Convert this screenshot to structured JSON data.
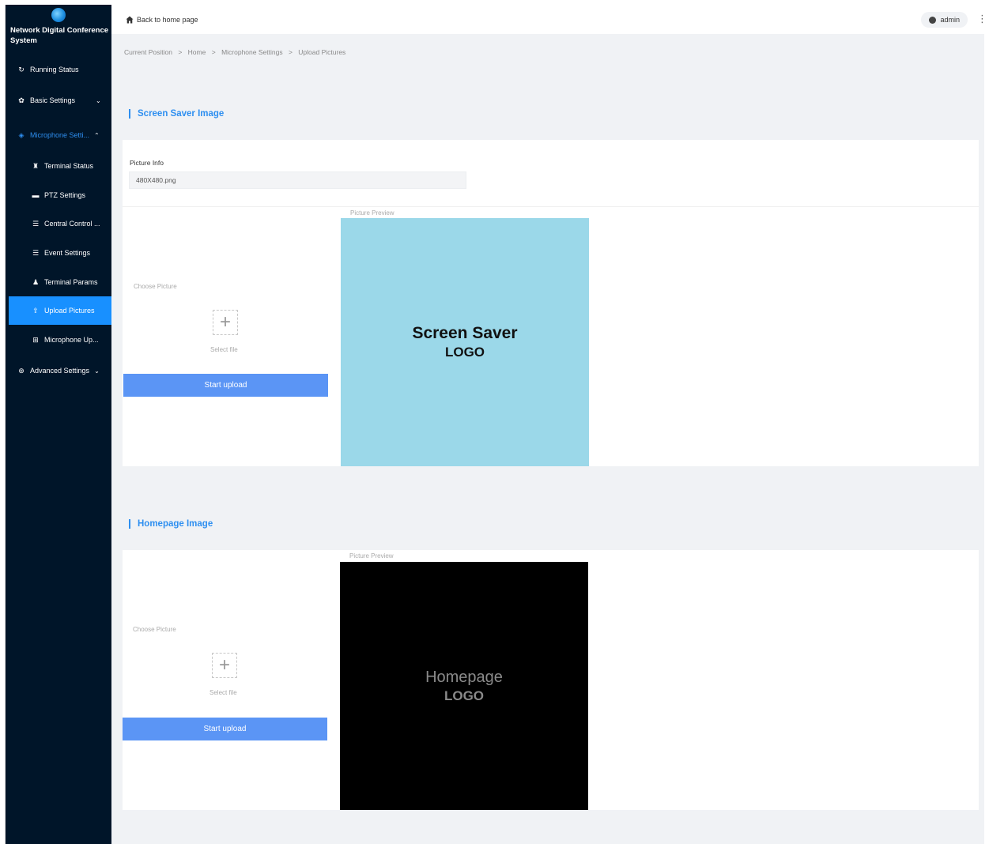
{
  "app": {
    "title": "Network Digital Conference System"
  },
  "sidebar": {
    "items": [
      {
        "label": "Running Status",
        "icon": "refresh-icon"
      },
      {
        "label": "Basic Settings",
        "icon": "gear-icon"
      },
      {
        "label": "Microphone Setti...",
        "icon": "microphone-icon"
      },
      {
        "label": "Terminal Status",
        "icon": "users-icon"
      },
      {
        "label": "PTZ Settings",
        "icon": "flag-icon"
      },
      {
        "label": "Central Control ...",
        "icon": "list-icon"
      },
      {
        "label": "Event Settings",
        "icon": "list-icon"
      },
      {
        "label": "Terminal Params",
        "icon": "people-icon"
      },
      {
        "label": "Upload Pictures",
        "icon": "upload-icon"
      },
      {
        "label": "Microphone Up...",
        "icon": "plus-square-icon"
      },
      {
        "label": "Advanced Settings",
        "icon": "compass-icon"
      }
    ]
  },
  "header": {
    "back_label": "Back to home page",
    "user": "admin"
  },
  "breadcrumb": [
    "Current Position",
    ">",
    "Home",
    ">",
    "Microphone Settings",
    ">",
    "Upload Pictures"
  ],
  "screen_saver": {
    "title": "Screen Saver Image",
    "picture_info_label": "Picture Info",
    "picture_info_value": "480X480.png",
    "preview_label": "Picture Preview",
    "choose_label": "Choose Picture",
    "select_file": "Select file",
    "upload_button": "Start upload",
    "preview_line1": "Screen Saver",
    "preview_line2": "LOGO",
    "preview_bg": "#9bd8e9"
  },
  "homepage": {
    "title": "Homepage Image",
    "preview_label": "Picture Preview",
    "choose_label": "Choose Picture",
    "select_file": "Select file",
    "upload_button": "Start upload",
    "preview_line1": "Homepage",
    "preview_line2": "LOGO",
    "preview_bg": "#000000"
  },
  "colors": {
    "sidebar_bg": "#001529",
    "accent": "#1890ff",
    "button": "#5b95f5"
  }
}
